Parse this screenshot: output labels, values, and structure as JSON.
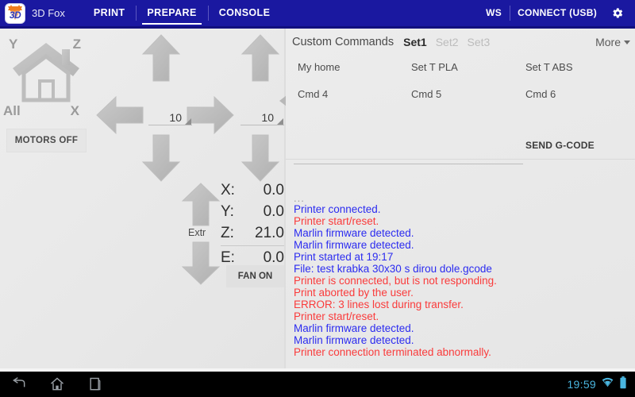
{
  "appbar": {
    "app_title": "3D Fox",
    "logo_text": "3D",
    "tabs": [
      {
        "label": "PRINT",
        "active": false
      },
      {
        "label": "PREPARE",
        "active": true
      },
      {
        "label": "CONSOLE",
        "active": false
      }
    ],
    "ws_label": "WS",
    "connect_label": "CONNECT (USB)",
    "settings_icon": "gear-icon",
    "bg_color": "#1a18a0"
  },
  "left_pane": {
    "home": {
      "icon": "house-icon",
      "axis_y": "Y",
      "axis_z": "Z",
      "axis_all": "All",
      "axis_x": "X"
    },
    "motors_off_label": "MOTORS OFF",
    "xy_pad": {
      "up_icon": "arrow-up-icon",
      "down_icon": "arrow-down-icon",
      "left_icon": "arrow-left-icon",
      "right_icon": "arrow-right-icon",
      "step_value": "10"
    },
    "z_pad": {
      "up_icon": "arrow-up-icon",
      "down_icon": "arrow-down-icon",
      "step_value": "10"
    },
    "extruder": {
      "label": "Extr",
      "up_icon": "arrow-up-icon",
      "down_icon": "arrow-down-icon"
    },
    "coordinates": [
      {
        "axis": "X:",
        "value": "0.0"
      },
      {
        "axis": "Y:",
        "value": "0.0"
      },
      {
        "axis": "Z:",
        "value": "21.0"
      },
      {
        "axis": "E:",
        "value": "0.0"
      }
    ],
    "fan_label": "FAN ON"
  },
  "right_pane": {
    "custom_commands": {
      "title": "Custom Commands",
      "sets": [
        {
          "label": "Set1",
          "active": true
        },
        {
          "label": "Set2",
          "active": false
        },
        {
          "label": "Set3",
          "active": false
        }
      ],
      "more_label": "More",
      "more_icon": "chevron-down-icon",
      "commands": [
        {
          "label": "My home"
        },
        {
          "label": "Set T PLA"
        },
        {
          "label": "Set T ABS"
        },
        {
          "label": "Cmd 4"
        },
        {
          "label": "Cmd 5"
        },
        {
          "label": "Cmd 6"
        }
      ],
      "gcode_input_value": "",
      "gcode_input_placeholder": "",
      "send_label": "SEND G-CODE"
    },
    "console_log": {
      "lines": [
        {
          "text": "...",
          "color": "dots"
        },
        {
          "text": "Printer connected.",
          "color": "blue"
        },
        {
          "text": "Printer start/reset.",
          "color": "red"
        },
        {
          "text": "Marlin firmware detected.",
          "color": "blue"
        },
        {
          "text": "Marlin firmware detected.",
          "color": "blue"
        },
        {
          "text": "Print started at 19:17",
          "color": "blue"
        },
        {
          "text": "File: test krabka 30x30 s dirou dole.gcode",
          "color": "blue"
        },
        {
          "text": "Printer is connected, but is not responding.",
          "color": "red"
        },
        {
          "text": "Print aborted by the user.",
          "color": "red"
        },
        {
          "text": "ERROR: 3 lines lost during transfer.",
          "color": "red"
        },
        {
          "text": "Printer start/reset.",
          "color": "red"
        },
        {
          "text": "Marlin firmware detected.",
          "color": "blue"
        },
        {
          "text": "Marlin firmware detected.",
          "color": "blue"
        },
        {
          "text": "Printer connection terminated abnormally.",
          "color": "red"
        }
      ],
      "blue_color": "#2c2cf0",
      "red_color": "#fa3b3b"
    }
  },
  "system_bar": {
    "back_icon": "back-arrow-icon",
    "home_icon": "home-icon",
    "recents_icon": "recent-apps-icon",
    "clock": "19:59",
    "wifi_icon": "wifi-icon",
    "battery_icon": "battery-icon",
    "clock_color": "#4ab6e0"
  }
}
